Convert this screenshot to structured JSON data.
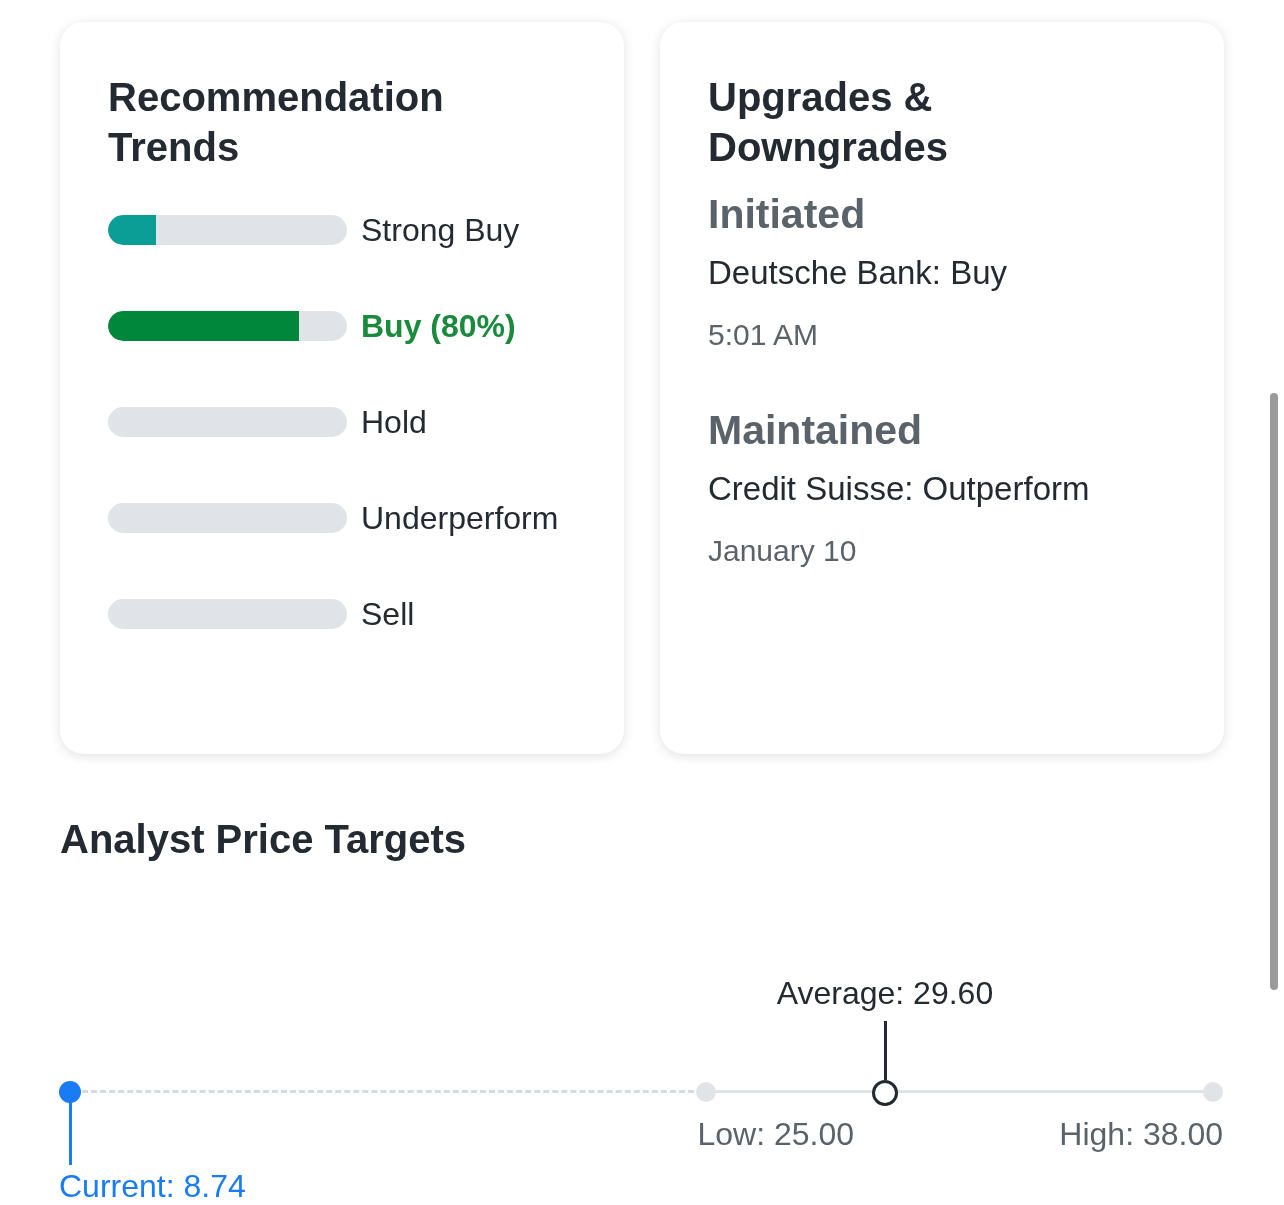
{
  "recommendation_trends": {
    "title": "Recommendation Trends",
    "rows": [
      {
        "label": "Strong Buy",
        "level": 0.2,
        "color": "#0a9e96",
        "selected": false
      },
      {
        "label": "Buy (80%)",
        "level": 0.8,
        "color": "#00873c",
        "selected": true
      },
      {
        "label": "Hold",
        "level": 0,
        "selected": false
      },
      {
        "label": "Underperform",
        "level": 0,
        "selected": false
      },
      {
        "label": "Sell",
        "level": 0,
        "selected": false
      }
    ]
  },
  "upgrades_downgrades": {
    "title": "Upgrades & Downgrades",
    "items": [
      {
        "action": "Initiated",
        "detail": "Deutsche Bank: Buy",
        "time": "5:01 AM"
      },
      {
        "action": "Maintained",
        "detail": "Credit Suisse: Outperform",
        "time": "January 10"
      }
    ]
  },
  "analyst_price_targets": {
    "title": "Analyst Price Targets",
    "markers": [
      {
        "kind": "current",
        "label": "Current: 8.74",
        "level": 0
      },
      {
        "kind": "low",
        "label": "Low: 25.00",
        "level": 0.556
      },
      {
        "kind": "average",
        "label": "Average: 29.60",
        "level": 0.713
      },
      {
        "kind": "high",
        "label": "High: 38.00",
        "level": 1
      }
    ]
  }
}
